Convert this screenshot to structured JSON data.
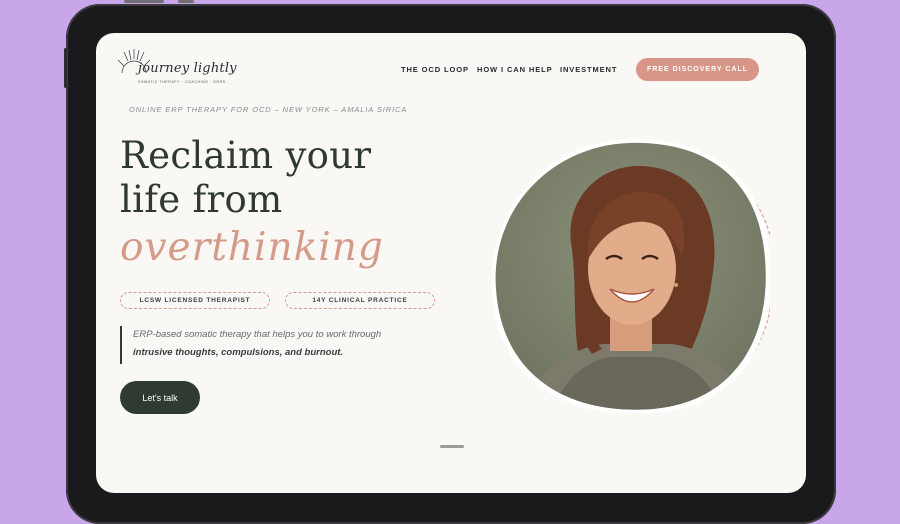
{
  "brand": {
    "name": "journey lightly",
    "tagline": "SOMATIC THERAPY · COACHING · ERRS"
  },
  "nav": {
    "items": [
      "THE OCD LOOP",
      "HOW I CAN HELP",
      "INVESTMENT"
    ],
    "cta": "FREE DISCOVERY CALL"
  },
  "hero": {
    "eyebrow": "ONLINE ERP THERAPY FOR OCD – NEW YORK – AMALIA SIRICA",
    "headline_line1": "Reclaim your",
    "headline_line2": "life from",
    "headline_accent": "overthinking",
    "badges": [
      "LCSW LICENSED THERAPIST",
      "14Y CLINICAL PRACTICE"
    ],
    "description_line1": "ERP-based somatic therapy that helps you to work through",
    "description_line2": "intrusive thoughts, compulsions, and burnout.",
    "cta": "Let's talk"
  },
  "colors": {
    "background": "#c9a6ea",
    "page": "#faf8f4",
    "accent": "#d89688",
    "dark_green": "#2f3b31"
  },
  "icons": [
    "sun-logo-icon"
  ]
}
